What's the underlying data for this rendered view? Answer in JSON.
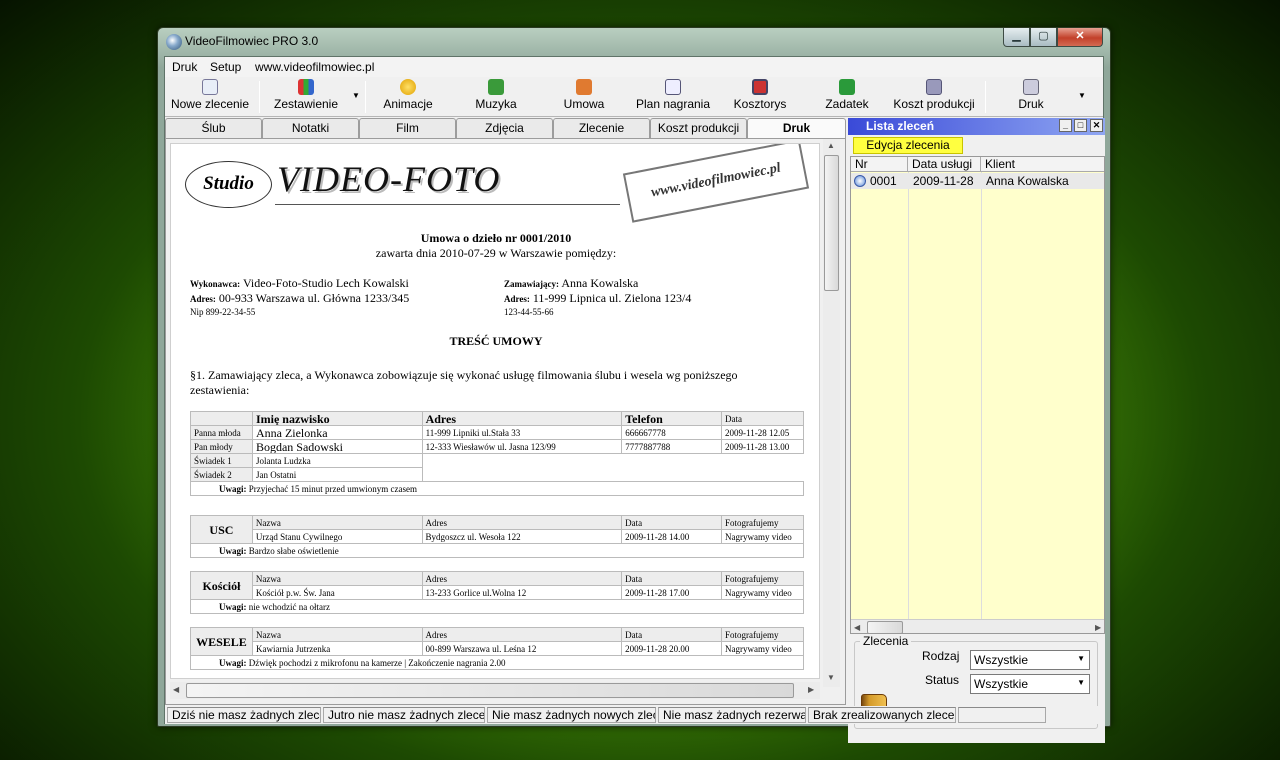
{
  "window": {
    "title": "VideoFilmowiec  PRO 3.0"
  },
  "menu": {
    "items": [
      "Druk",
      "Setup",
      "www.videofilmowiec.pl"
    ]
  },
  "toolbar": {
    "buttons": [
      "Nowe zlecenie",
      "Zestawienie",
      "Animacje",
      "Muzyka",
      "Umowa",
      "Plan nagrania",
      "Kosztorys",
      "Zadatek",
      "Koszt produkcji",
      "Druk"
    ]
  },
  "tabs": [
    "Ślub",
    "Notatki",
    "Film",
    "Zdjęcia",
    "Zlecenie",
    "Koszt produkcji",
    "Druk"
  ],
  "doc": {
    "logo_oval": "Studio",
    "logo_main": "VIDEO-FOTO",
    "logo_url": "www.videofilmowiec.pl",
    "contract_title": "Umowa o dzieło nr 0001/2010",
    "contract_sub": "zawarta dnia 2010-07-29 w Warszawie pomiędzy:",
    "wyk_label": "Wykonawca:",
    "wyk_value": "Video-Foto-Studio Lech Kowalski",
    "adr_label": "Adres:",
    "wyk_addr": "00-933 Warszawa ul. Główna 1233/345",
    "nip": "Nip 899-22-34-55",
    "zam_label": "Zamawiający:",
    "zam_value": "Anna Kowalska",
    "zam_addr": "11-999 Lipnica ul. Zielona 123/4",
    "zam_phone": "123-44-55-66",
    "tresc": "TREŚĆ UMOWY",
    "par1_l1": "§1. Zamawiający zleca, a Wykonawca zobowiązuje się wykonać usługę filmowania ślubu i wesela wg poniższego",
    "par1_l2": "zestawienia:",
    "persons": {
      "headers": [
        "Imię nazwisko",
        "Adres",
        "Telefon",
        "Data"
      ],
      "rows": [
        [
          "Panna młoda",
          "Anna Zielonka",
          "11-999 Lipniki ul.Stała 33",
          "666667778",
          "2009-11-28 12.05"
        ],
        [
          "Pan młody",
          "Bogdan Sadowski",
          "12-333 Wiesławów ul. Jasna 123/99",
          "7777887788",
          "2009-11-28 13.00"
        ],
        [
          "Świadek 1",
          "Jolanta Ludzka"
        ],
        [
          "Świadek 2",
          "Jan Ostatni"
        ]
      ],
      "uwagi_label": "Uwagi:",
      "uwagi": "Przyjechać 15 minut przed umwionym czasem"
    },
    "events": [
      {
        "label": "USC",
        "nazwa": "Urząd Stanu Cywilnego",
        "adres": "Bydgoszcz ul. Wesoła 122",
        "data": "2009-11-28 14.00",
        "foto": "Nagrywamy video",
        "uwagi": "Bardzo słabe oświetlenie"
      },
      {
        "label": "Kościół",
        "nazwa": "Kościół p.w. Św. Jana",
        "adres": "13-233 Gorlice ul.Wolna 12",
        "data": "2009-11-28 17.00",
        "foto": "Nagrywamy video",
        "uwagi": "nie wchodzić na ołtarz"
      },
      {
        "label": "WESELE",
        "nazwa": "Kawiarnia Jutrzenka",
        "adres": "00-899 Warszawa ul. Leśna 12",
        "data": "2009-11-28 20.00",
        "foto": "Nagrywamy video",
        "uwagi": "Dźwięk pochodzi z mikrofonu na kamerze | Zakończenie nagrania 2.00"
      }
    ],
    "event_headers": [
      "Nazwa",
      "Adres",
      "Data",
      "Fotografujemy"
    ]
  },
  "lista": {
    "title": "Lista zleceń",
    "edit_button": "Edycja zlecenia",
    "columns": [
      "Nr",
      "Data usługi",
      "Klient"
    ],
    "rows": [
      [
        "0001",
        "2009-11-28",
        "Anna Kowalska"
      ]
    ],
    "filters_title": "Zlecenia",
    "rodzaj_label": "Rodzaj",
    "rodzaj_value": "Wszystkie",
    "status_label": "Status",
    "status_value": "Wszystkie"
  },
  "status": [
    "Dziś nie masz żadnych zleceń",
    "Jutro nie masz żadnych zleceń",
    "Nie masz żadnych nowych zleceń",
    "Nie masz żadnych rezerwacji",
    "Brak zrealizowanych zleceń"
  ],
  "colors": {
    "list_header": "#3a4ad8",
    "edit_button": "#ffff40",
    "grid_bg": "#ffffcc",
    "close_button": "#c2402a"
  }
}
